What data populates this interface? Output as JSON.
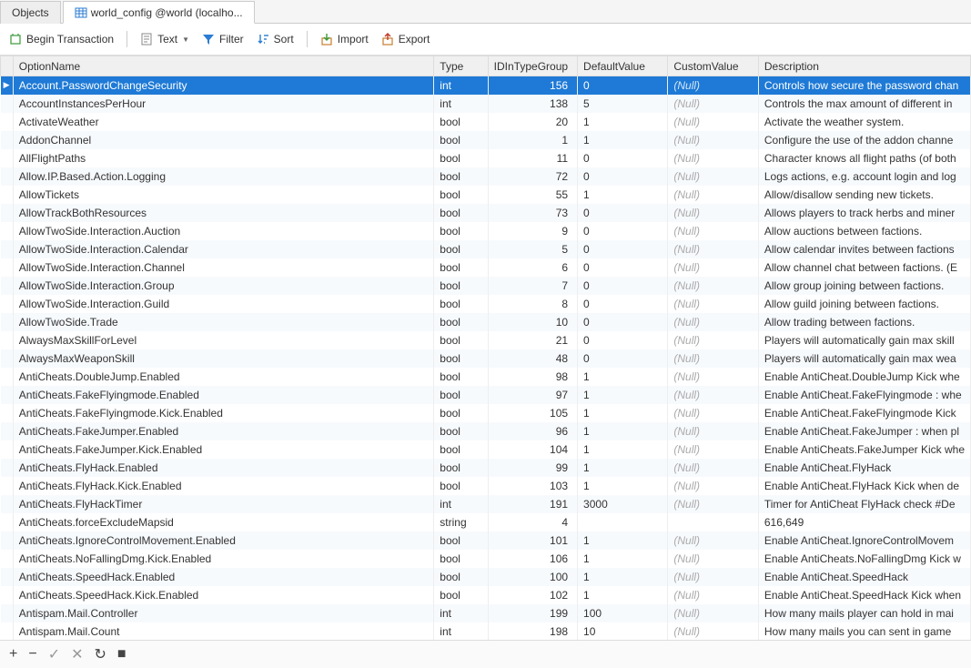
{
  "tabs": {
    "objects": "Objects",
    "active": "world_config @world (localho..."
  },
  "toolbar": {
    "begin_transaction": "Begin Transaction",
    "text": "Text",
    "filter": "Filter",
    "sort": "Sort",
    "import": "Import",
    "export": "Export"
  },
  "columns": {
    "optionname": "OptionName",
    "type": "Type",
    "id": "IDInTypeGroup",
    "default": "DefaultValue",
    "custom": "CustomValue",
    "desc": "Description"
  },
  "null_label": "(Null)",
  "rows": [
    {
      "name": "Account.PasswordChangeSecurity",
      "type": "int",
      "id": "156",
      "def": "0",
      "custom": null,
      "desc": "Controls how secure the password chan",
      "selected": true
    },
    {
      "name": "AccountInstancesPerHour",
      "type": "int",
      "id": "138",
      "def": "5",
      "custom": null,
      "desc": "Controls the max amount of different in"
    },
    {
      "name": "ActivateWeather",
      "type": "bool",
      "id": "20",
      "def": "1",
      "custom": null,
      "desc": "Activate the weather system."
    },
    {
      "name": "AddonChannel",
      "type": "bool",
      "id": "1",
      "def": "1",
      "custom": null,
      "desc": "Configure the use of the addon channe"
    },
    {
      "name": "AllFlightPaths",
      "type": "bool",
      "id": "11",
      "def": "0",
      "custom": null,
      "desc": "Character knows all flight paths (of both"
    },
    {
      "name": "Allow.IP.Based.Action.Logging",
      "type": "bool",
      "id": "72",
      "def": "0",
      "custom": null,
      "desc": "Logs actions, e.g. account login and log"
    },
    {
      "name": "AllowTickets",
      "type": "bool",
      "id": "55",
      "def": "1",
      "custom": null,
      "desc": "Allow/disallow sending new tickets."
    },
    {
      "name": "AllowTrackBothResources",
      "type": "bool",
      "id": "73",
      "def": "0",
      "custom": null,
      "desc": "Allows players to track herbs and miner"
    },
    {
      "name": "AllowTwoSide.Interaction.Auction",
      "type": "bool",
      "id": "9",
      "def": "0",
      "custom": null,
      "desc": "Allow auctions between factions."
    },
    {
      "name": "AllowTwoSide.Interaction.Calendar",
      "type": "bool",
      "id": "5",
      "def": "0",
      "custom": null,
      "desc": "Allow calendar invites between factions"
    },
    {
      "name": "AllowTwoSide.Interaction.Channel",
      "type": "bool",
      "id": "6",
      "def": "0",
      "custom": null,
      "desc": "Allow channel chat between factions. (E"
    },
    {
      "name": "AllowTwoSide.Interaction.Group",
      "type": "bool",
      "id": "7",
      "def": "0",
      "custom": null,
      "desc": "Allow group joining between factions."
    },
    {
      "name": "AllowTwoSide.Interaction.Guild",
      "type": "bool",
      "id": "8",
      "def": "0",
      "custom": null,
      "desc": "Allow guild joining between factions."
    },
    {
      "name": "AllowTwoSide.Trade",
      "type": "bool",
      "id": "10",
      "def": "0",
      "custom": null,
      "desc": "Allow trading between factions."
    },
    {
      "name": "AlwaysMaxSkillForLevel",
      "type": "bool",
      "id": "21",
      "def": "0",
      "custom": null,
      "desc": "Players will automatically gain max skill"
    },
    {
      "name": "AlwaysMaxWeaponSkill",
      "type": "bool",
      "id": "48",
      "def": "0",
      "custom": null,
      "desc": "Players will automatically gain max wea"
    },
    {
      "name": "AntiCheats.DoubleJump.Enabled",
      "type": "bool",
      "id": "98",
      "def": "1",
      "custom": null,
      "desc": "Enable AntiCheat.DoubleJump Kick whe"
    },
    {
      "name": "AntiCheats.FakeFlyingmode.Enabled",
      "type": "bool",
      "id": "97",
      "def": "1",
      "custom": null,
      "desc": "Enable AntiCheat.FakeFlyingmode : whe"
    },
    {
      "name": "AntiCheats.FakeFlyingmode.Kick.Enabled",
      "type": "bool",
      "id": "105",
      "def": "1",
      "custom": null,
      "desc": "Enable AntiCheat.FakeFlyingmode Kick"
    },
    {
      "name": "AntiCheats.FakeJumper.Enabled",
      "type": "bool",
      "id": "96",
      "def": "1",
      "custom": null,
      "desc": "Enable AntiCheat.FakeJumper : when pl"
    },
    {
      "name": "AntiCheats.FakeJumper.Kick.Enabled",
      "type": "bool",
      "id": "104",
      "def": "1",
      "custom": null,
      "desc": "Enable AntiCheats.FakeJumper Kick whe"
    },
    {
      "name": "AntiCheats.FlyHack.Enabled",
      "type": "bool",
      "id": "99",
      "def": "1",
      "custom": null,
      "desc": "Enable AntiCheat.FlyHack"
    },
    {
      "name": "AntiCheats.FlyHack.Kick.Enabled",
      "type": "bool",
      "id": "103",
      "def": "1",
      "custom": null,
      "desc": "Enable AntiCheat.FlyHack Kick when de"
    },
    {
      "name": "AntiCheats.FlyHackTimer",
      "type": "int",
      "id": "191",
      "def": "3000",
      "custom": null,
      "desc": "Timer for AntiCheat FlyHack check #De"
    },
    {
      "name": "AntiCheats.forceExcludeMapsid",
      "type": "string",
      "id": "4",
      "def": "",
      "custom": "",
      "desc": "616,649"
    },
    {
      "name": "AntiCheats.IgnoreControlMovement.Enabled",
      "type": "bool",
      "id": "101",
      "def": "1",
      "custom": null,
      "desc": "Enable AntiCheat.IgnoreControlMovem"
    },
    {
      "name": "AntiCheats.NoFallingDmg.Kick.Enabled",
      "type": "bool",
      "id": "106",
      "def": "1",
      "custom": null,
      "desc": "Enable AntiCheats.NoFallingDmg Kick w"
    },
    {
      "name": "AntiCheats.SpeedHack.Enabled",
      "type": "bool",
      "id": "100",
      "def": "1",
      "custom": null,
      "desc": "Enable AntiCheat.SpeedHack"
    },
    {
      "name": "AntiCheats.SpeedHack.Kick.Enabled",
      "type": "bool",
      "id": "102",
      "def": "1",
      "custom": null,
      "desc": "Enable AntiCheat.SpeedHack Kick when"
    },
    {
      "name": "Antispam.Mail.Controller",
      "type": "int",
      "id": "199",
      "def": "100",
      "custom": null,
      "desc": "How many mails player can hold in mai"
    },
    {
      "name": "Antispam.Mail.Count",
      "type": "int",
      "id": "198",
      "def": "10",
      "custom": null,
      "desc": "How many mails you can sent in game"
    }
  ]
}
